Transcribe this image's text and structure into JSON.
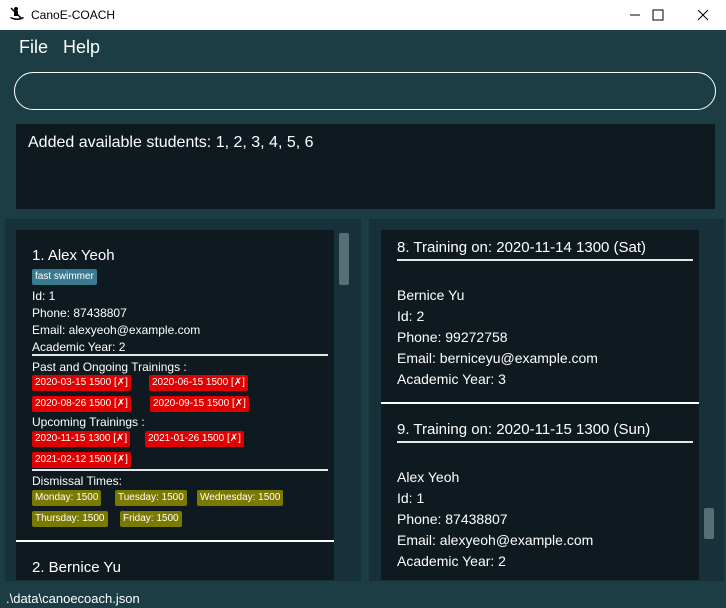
{
  "window": {
    "title": "CanoE-COACH"
  },
  "menu": {
    "file": "File",
    "help": "Help"
  },
  "command": {
    "value": ""
  },
  "result": {
    "text": "Added available students: 1, 2, 3, 4, 5, 6"
  },
  "students": [
    {
      "heading": "1.  Alex Yeoh",
      "tag": "fast swimmer",
      "id": "Id: 1",
      "phone": "Phone: 87438807",
      "email": "Email: alexyeoh@example.com",
      "year": "Academic Year: 2",
      "past_label": "Past and Ongoing Trainings :",
      "past": [
        "2020-03-15 1500 [✗]",
        "2020-06-15 1500 [✗]",
        "2020-08-26 1500 [✗]",
        "2020-09-15 1500 [✗]"
      ],
      "upcoming_label": "Upcoming Trainings :",
      "upcoming": [
        "2020-11-15 1300 [✗]",
        "2021-01-26 1500 [✗]",
        "2021-02-12 1500 [✗]"
      ],
      "dismissal_label": "Dismissal Times:",
      "dismissal": [
        "Monday: 1500",
        "Tuesday: 1500",
        "Wednesday: 1500",
        "Thursday: 1500",
        "Friday: 1500"
      ]
    },
    {
      "heading": "2.  Bernice Yu"
    }
  ],
  "trainings": [
    {
      "heading": "8.  Training on: 2020-11-14 1300 (Sat)",
      "name": "Bernice Yu",
      "id": "Id: 2",
      "phone": "Phone: 99272758",
      "email": "Email: berniceyu@example.com",
      "year": "Academic  Year: 3"
    },
    {
      "heading": "9.  Training on: 2020-11-15 1300 (Sun)",
      "name": "Alex Yeoh",
      "id": "Id: 1",
      "phone": "Phone: 87438807",
      "email": "Email: alexyeoh@example.com",
      "year": "Academic  Year: 2"
    }
  ],
  "status": {
    "path": ".\\data\\canoecoach.json"
  },
  "colors": {
    "background": "#1d3d44",
    "list_bg": "#0e1a1f",
    "red_tag": "#e00000",
    "gold_tag": "#7a7a00",
    "blue_tag": "#3a7a90"
  },
  "icons": {
    "app": "canoe-icon",
    "minimize": "minimize-icon",
    "maximize": "maximize-icon",
    "close": "close-icon"
  }
}
